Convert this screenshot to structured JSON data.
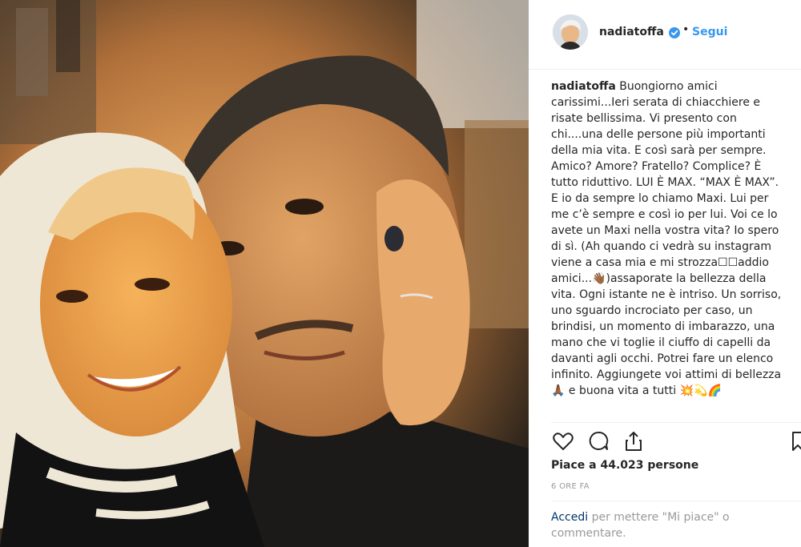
{
  "post": {
    "username": "nadiatoffa",
    "separator": "•",
    "follow_label": "Segui",
    "caption_username": "nadiatoffa",
    "caption_text": " Buongiorno amici\ncarissimi...Ieri serata di chiacchiere e\nrisate bellissima. Vi presento con\nchi....una delle persone più importanti\ndella mia vita. E così sarà per sempre.\nAmico? Amore? Fratello? Complice? È\ntutto riduttivo. LUI È MAX. “MAX È MAX”.\nE io da sempre lo chiamo Maxi. Lui per\nme c’è sempre e così io per lui. Voi ce lo\navete un Maxi nella vostra vita? Io spero\ndi sì. (Ah quando ci vedrà su instagram\nviene a casa mia e mi strozza☐☐addio\namici...👋🏾)assaporate la bellezza della\nvita. Ogni istante ne è intriso. Un sorriso,\nuno sguardo incrociato per caso, un\nbrindisi, un momento di imbarazzo, una\nmano che vi toglie il ciuffo di capelli da\ndavanti agli occhi. Potrei fare un elenco\ninfinito. Aggiungete voi attimi di bellezza\n🙏🏾 e buona vita a tutti 💥💫🌈",
    "likes_text": "Piace a 44.023 persone",
    "time_text": "6 ORE FA",
    "login_link": "Accedi",
    "login_rest": " per mettere \"Mi piace\" o commentare."
  },
  "icons": {
    "verified": "verified-badge-icon",
    "like": "heart-icon",
    "comment": "comment-icon",
    "share": "share-icon",
    "save": "bookmark-icon"
  },
  "colors": {
    "link_blue": "#3897f0",
    "verified_blue": "#3897f0"
  }
}
